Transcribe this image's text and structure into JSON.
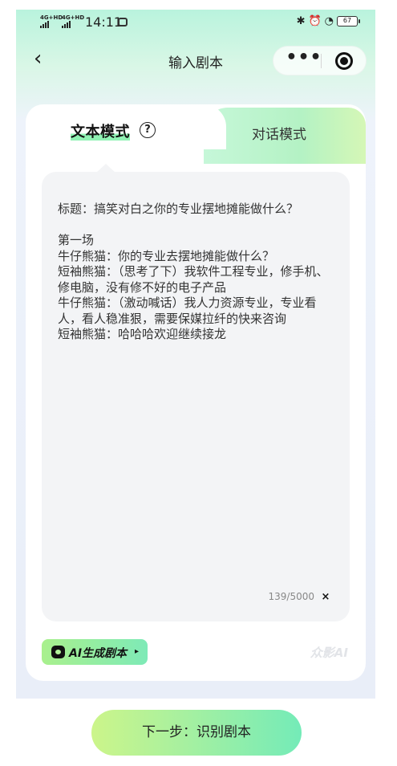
{
  "status_bar": {
    "signal_1": "4G+HD",
    "signal_2": "4G+HD",
    "time": "14:11",
    "battery": "67"
  },
  "nav": {
    "back_icon": "chevron-left",
    "title": "输入剧本",
    "more_icon": "more-dots",
    "close_icon": "target-circle"
  },
  "tabs": {
    "active": "文本模式",
    "help_icon": "?",
    "inactive": "对话模式"
  },
  "editor": {
    "text": "标题：搞笑对白之你的专业摆地摊能做什么？\n\n第一场\n牛仔熊猫：你的专业去摆地摊能做什么？\n短袖熊猫：（思考了下）我软件工程专业，修手机、修电脑，没有修不好的电子产品\n牛仔熊猫：（激动喊话）我人力资源专业，专业看人，看人稳准狠，需要保媒拉纤的快来咨询\n短袖熊猫：哈哈哈欢迎继续接龙",
    "counter": "139/5000",
    "clear_label": "×"
  },
  "ai_button": {
    "label": "AI生成剧本",
    "caret": "▸"
  },
  "brand_watermark": "众影AI",
  "next_button": "下一步：识别剧本",
  "colors": {
    "accent_green": "#8ff2b3",
    "button_gradient_start": "#ccf58a",
    "button_gradient_end": "#74ebb8"
  }
}
